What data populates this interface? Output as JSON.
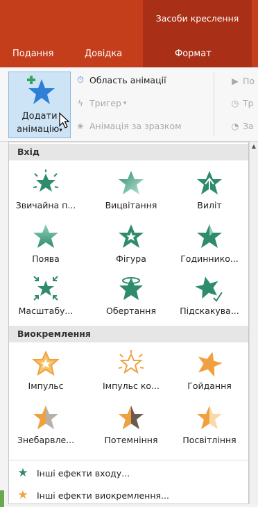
{
  "ribbon": {
    "context_group": "Засоби креслення",
    "tabs": [
      "Подання",
      "Довідка",
      "Формат"
    ],
    "add_animation_label": [
      "Додати",
      "анімацію"
    ],
    "add_animation_caret": "▾",
    "commands": {
      "animation_pane": "Область анімації",
      "trigger": "Тригер",
      "trigger_caret": "▾",
      "animation_painter": "Анімація за зразком",
      "cut1": "По",
      "cut2": "Тр",
      "cut3": "За"
    }
  },
  "gallery": {
    "entrance_header": "Вхід",
    "entrance": [
      {
        "label": "Звичайна п...",
        "icon": "star-appear-burst-icon"
      },
      {
        "label": "Вицвітання",
        "icon": "star-fade-icon"
      },
      {
        "label": "Виліт",
        "icon": "star-fly-in-icon"
      },
      {
        "label": "Поява",
        "icon": "star-float-in-icon"
      },
      {
        "label": "Фігура",
        "icon": "star-shape-icon"
      },
      {
        "label": "Годиннико...",
        "icon": "star-wheel-icon"
      },
      {
        "label": "Масштабу...",
        "icon": "star-zoom-icon"
      },
      {
        "label": "Обертання",
        "icon": "star-swivel-icon"
      },
      {
        "label": "Підскакува...",
        "icon": "star-bounce-icon"
      }
    ],
    "emphasis_header": "Виокремлення",
    "emphasis": [
      {
        "label": "Імпульс",
        "icon": "star-pulse-icon"
      },
      {
        "label": "Імпульс ко...",
        "icon": "star-color-pulse-icon"
      },
      {
        "label": "Гойдання",
        "icon": "star-teeter-icon"
      },
      {
        "label": "Знебарвле...",
        "icon": "star-desaturate-icon"
      },
      {
        "label": "Потемніння",
        "icon": "star-darken-icon"
      },
      {
        "label": "Посвітління",
        "icon": "star-lighten-icon"
      }
    ],
    "more_entrance": "Інші ефекти входу...",
    "more_emphasis": "Інші ефекти виокремлення..."
  },
  "colors": {
    "ribbon_red": "#c43e1c",
    "context_red": "#a93016",
    "entrance_green": "#2e8b6e",
    "emphasis_orange": "#f0a040"
  }
}
